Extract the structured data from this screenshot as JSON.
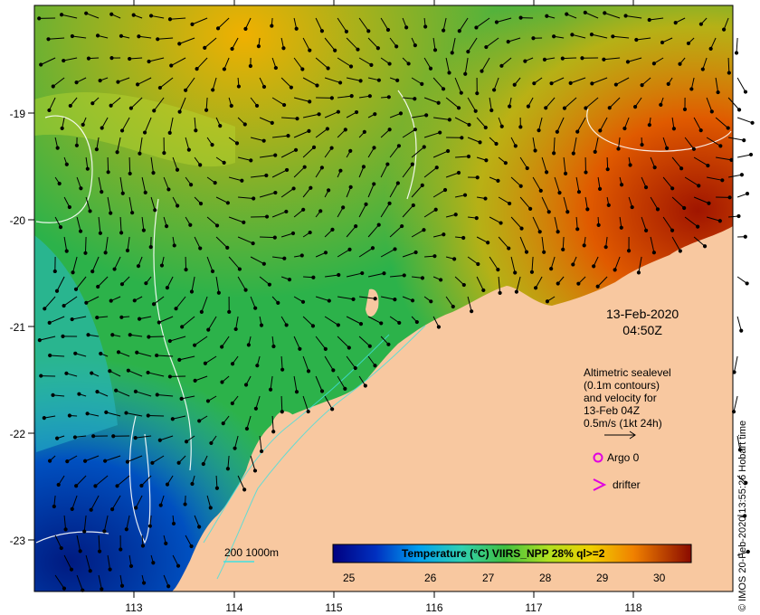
{
  "map": {
    "datetime_line1": "13-Feb-2020",
    "datetime_line2": "04:50Z",
    "x_ticks": [
      "113",
      "114",
      "115",
      "116",
      "117",
      "118"
    ],
    "y_ticks": [
      "-19",
      "-20",
      "-21",
      "-22",
      "-23"
    ],
    "colors": {
      "land": "#f8c8a0",
      "ocean_cold": "#0a2a8a",
      "ocean_warm": "#9a1a00",
      "contour": "#ffffff"
    }
  },
  "legend": {
    "altimetry_lines": [
      "Altimetric sealevel",
      "(0.1m contours)",
      "and velocity for",
      "13-Feb 04Z",
      "0.5m/s (1kt 24h)"
    ],
    "argo_label": "Argo 0",
    "drifter_label": "drifter",
    "depth_label": "200  1000m",
    "argo_color": "#e000e0",
    "drifter_color": "#e000e0"
  },
  "colorbar": {
    "title": "Temperature (°C) VIIRS_NPP 28% ql>=2",
    "ticks": [
      "25",
      "26",
      "27",
      "28",
      "29",
      "30"
    ]
  },
  "credit": "© IMOS 20-Feb-2020 13:55:26 Hobart time"
}
